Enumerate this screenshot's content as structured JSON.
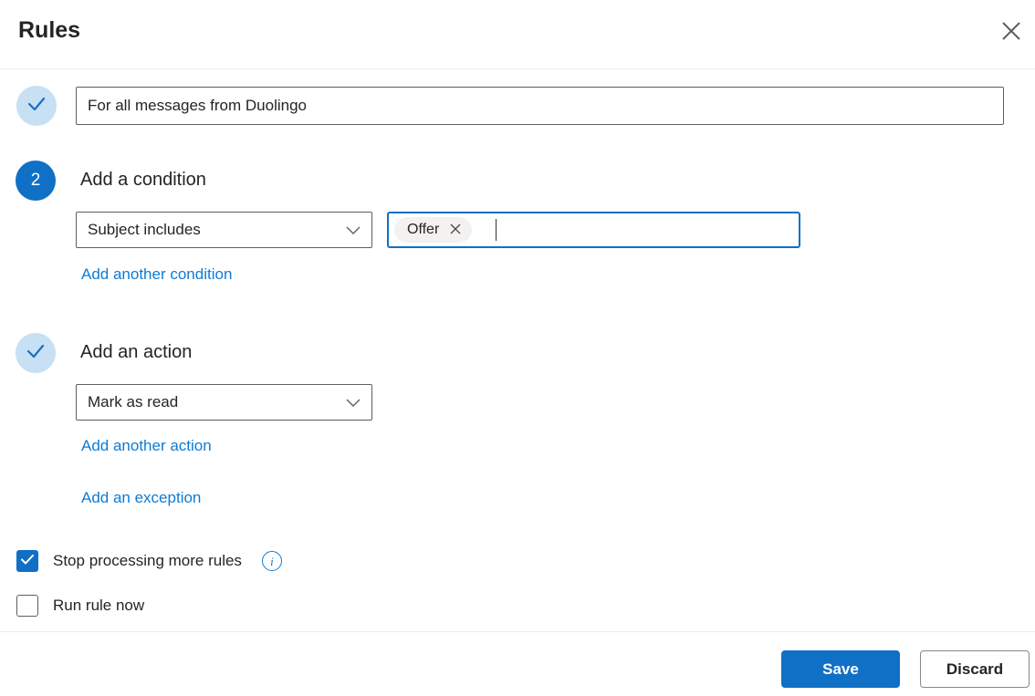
{
  "dialog": {
    "title": "Rules"
  },
  "rule_name": {
    "value": "For all messages from Duolingo"
  },
  "condition": {
    "step_number": "2",
    "heading": "Add a condition",
    "operator": "Subject includes",
    "tag": "Offer",
    "add_link": "Add another condition"
  },
  "action": {
    "heading": "Add an action",
    "operator": "Mark as read",
    "add_link": "Add another action",
    "exception_link": "Add an exception"
  },
  "options": {
    "stop_processing": {
      "label": "Stop processing more rules",
      "checked": true
    },
    "run_now": {
      "label": "Run rule now",
      "checked": false
    }
  },
  "footer": {
    "save_label": "Save",
    "discard_label": "Discard"
  },
  "icons": {
    "close": "close-icon",
    "chevron": "chevron-down-icon",
    "check": "checkmark-icon",
    "info": "info-icon",
    "info_glyph": "i"
  },
  "colors": {
    "brand_blue": "#1070c5",
    "link_blue": "#0f7ad4",
    "step_done_bg": "#c7e0f4",
    "step_check": "#1b6ec2",
    "text": "#252423",
    "input_border": "#605e5c",
    "pill_bg": "#f3f2f1",
    "divider": "#efedeb",
    "discard_border": "#8a8886"
  }
}
